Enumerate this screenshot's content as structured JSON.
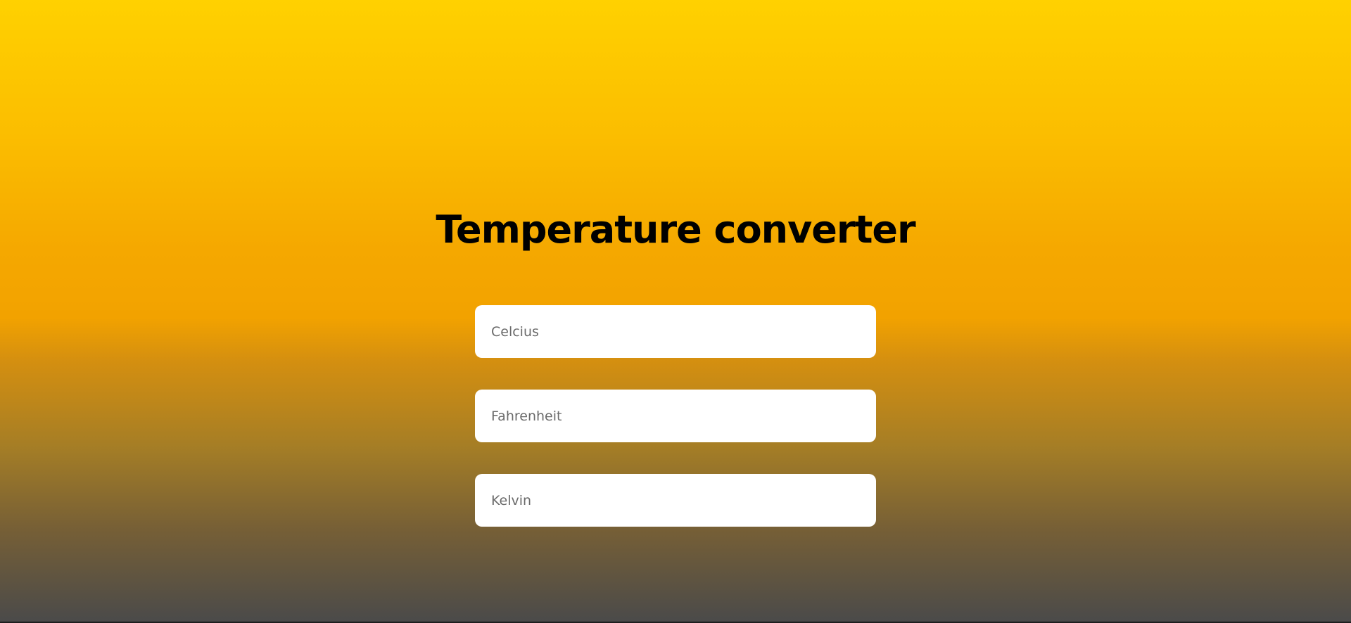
{
  "app": {
    "title": "Temperature converter"
  },
  "fields": {
    "celcius": {
      "placeholder": "Celcius",
      "value": ""
    },
    "fahrenheit": {
      "placeholder": "Fahrenheit",
      "value": ""
    },
    "kelvin": {
      "placeholder": "Kelvin",
      "value": ""
    }
  },
  "colors": {
    "gradient_top": "#ffd100",
    "gradient_mid": "#f2a200",
    "gradient_bottom": "#4a4a4a",
    "input_background": "#ffffff",
    "title_text": "#000000",
    "placeholder_text": "#6b6b6b"
  }
}
